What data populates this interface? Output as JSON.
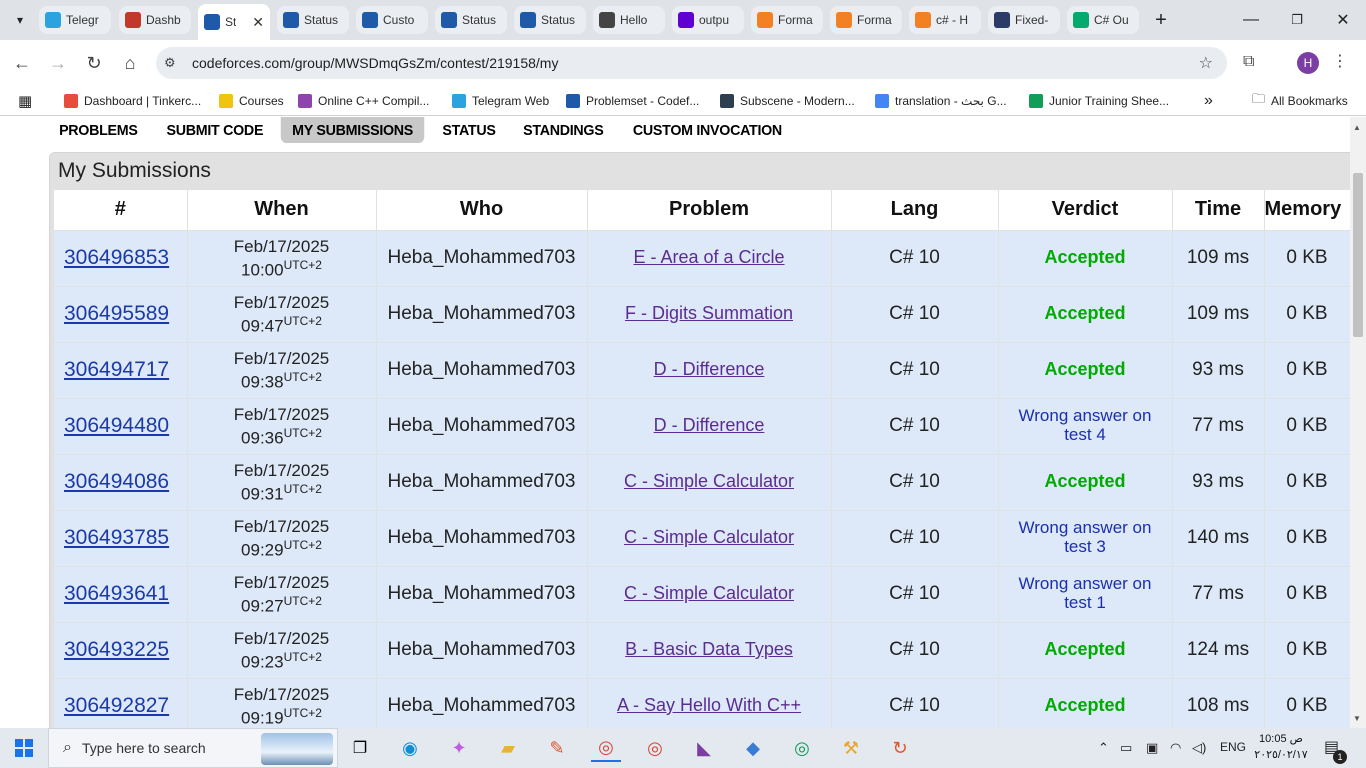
{
  "browser": {
    "tabs": [
      {
        "label": "Telegr",
        "icon": "telegram-icon",
        "color": "#2aa3de"
      },
      {
        "label": "Dashb",
        "icon": "chart-icon",
        "color": "#c0392b"
      },
      {
        "label": "St",
        "icon": "chart-icon",
        "color": "#1e5aa8",
        "active": true
      },
      {
        "label": "Status",
        "icon": "chart-icon",
        "color": "#1e5aa8"
      },
      {
        "label": "Custo",
        "icon": "chart-icon",
        "color": "#1e5aa8"
      },
      {
        "label": "Status",
        "icon": "chart-icon",
        "color": "#1e5aa8"
      },
      {
        "label": "Status",
        "icon": "chart-icon",
        "color": "#1e5aa8"
      },
      {
        "label": "Hello",
        "icon": "openai-icon",
        "color": "#444444"
      },
      {
        "label": "outpu",
        "icon": "yahoo-icon",
        "color": "#5f01d1"
      },
      {
        "label": "Forma",
        "icon": "stackoverflow-icon",
        "color": "#f48024"
      },
      {
        "label": "Forma",
        "icon": "stackoverflow-icon",
        "color": "#f48024"
      },
      {
        "label": "c# - H",
        "icon": "stackoverflow-icon",
        "color": "#f48024"
      },
      {
        "label": "Fixed-",
        "icon": "hex-icon",
        "color": "#2b3a67"
      },
      {
        "label": "C# Ou",
        "icon": "w3schools-icon",
        "color": "#04aa6d"
      }
    ],
    "tab_close": "✕",
    "new_tab": "+",
    "url": "codeforces.com/group/MWSDmqGsZm/contest/219158/my",
    "profile_initial": "H",
    "bookmarks": [
      {
        "label": "Dashboard | Tinkerc...",
        "color": "#e74c3c"
      },
      {
        "label": "Courses",
        "color": "#f1c40f"
      },
      {
        "label": "Online C++ Compil...",
        "color": "#8e44ad"
      },
      {
        "label": "Telegram Web",
        "color": "#2aa3de"
      },
      {
        "label": "Problemset - Codef...",
        "color": "#1e5aa8"
      },
      {
        "label": "Subscene - Modern...",
        "color": "#2c3e50"
      },
      {
        "label": "translation - بحث G...",
        "color": "#4285f4"
      },
      {
        "label": "Junior Training Shee...",
        "color": "#0f9d58"
      }
    ],
    "bookmarks_more": "»",
    "all_bookmarks": "All Bookmarks"
  },
  "contest_menu": [
    "PROBLEMS",
    "SUBMIT CODE",
    "MY SUBMISSIONS",
    "STATUS",
    "STANDINGS",
    "CUSTOM INVOCATION"
  ],
  "box_title": "My Submissions",
  "table": {
    "headers": [
      "#",
      "When",
      "Who",
      "Problem",
      "Lang",
      "Verdict",
      "Time",
      "Memory"
    ],
    "tz": "UTC+2",
    "rows": [
      {
        "id": "306496853",
        "date": "Feb/17/2025",
        "time": "10:00",
        "who": "Heba_Mohammed703",
        "problem": "E - Area of a Circle",
        "lang": "C# 10",
        "verdict": "Accepted",
        "ok": true,
        "run": "109 ms",
        "mem": "0 KB"
      },
      {
        "id": "306495589",
        "date": "Feb/17/2025",
        "time": "09:47",
        "who": "Heba_Mohammed703",
        "problem": "F - Digits Summation",
        "lang": "C# 10",
        "verdict": "Accepted",
        "ok": true,
        "run": "109 ms",
        "mem": "0 KB"
      },
      {
        "id": "306494717",
        "date": "Feb/17/2025",
        "time": "09:38",
        "who": "Heba_Mohammed703",
        "problem": "D - Difference",
        "lang": "C# 10",
        "verdict": "Accepted",
        "ok": true,
        "run": "93 ms",
        "mem": "0 KB"
      },
      {
        "id": "306494480",
        "date": "Feb/17/2025",
        "time": "09:36",
        "who": "Heba_Mohammed703",
        "problem": "D - Difference",
        "lang": "C# 10",
        "verdict": "Wrong answer on test 4",
        "ok": false,
        "run": "77 ms",
        "mem": "0 KB"
      },
      {
        "id": "306494086",
        "date": "Feb/17/2025",
        "time": "09:31",
        "who": "Heba_Mohammed703",
        "problem": "C - Simple Calculator",
        "lang": "C# 10",
        "verdict": "Accepted",
        "ok": true,
        "run": "93 ms",
        "mem": "0 KB"
      },
      {
        "id": "306493785",
        "date": "Feb/17/2025",
        "time": "09:29",
        "who": "Heba_Mohammed703",
        "problem": "C - Simple Calculator",
        "lang": "C# 10",
        "verdict": "Wrong answer on test 3",
        "ok": false,
        "run": "140 ms",
        "mem": "0 KB"
      },
      {
        "id": "306493641",
        "date": "Feb/17/2025",
        "time": "09:27",
        "who": "Heba_Mohammed703",
        "problem": "C - Simple Calculator",
        "lang": "C# 10",
        "verdict": "Wrong answer on test 1",
        "ok": false,
        "run": "77 ms",
        "mem": "0 KB"
      },
      {
        "id": "306493225",
        "date": "Feb/17/2025",
        "time": "09:23",
        "who": "Heba_Mohammed703",
        "problem": "B - Basic Data Types",
        "lang": "C# 10",
        "verdict": "Accepted",
        "ok": true,
        "run": "124 ms",
        "mem": "0 KB"
      },
      {
        "id": "306492827",
        "date": "Feb/17/2025",
        "time": "09:19",
        "who": "Heba_Mohammed703",
        "problem": "A - Say Hello With C++",
        "lang": "C# 10",
        "verdict": "Accepted",
        "ok": true,
        "run": "108 ms",
        "mem": "0 KB"
      }
    ]
  },
  "taskbar": {
    "search_placeholder": "Type here to search",
    "language": "ENG",
    "clock_time": "10:05 ص",
    "clock_date": "٢٠٢٥/٠٢/١٧",
    "notification_count": "1"
  }
}
